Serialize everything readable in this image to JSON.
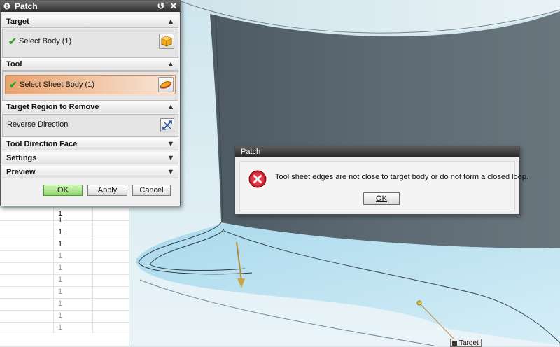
{
  "patch_dialog": {
    "title": "Patch",
    "sections": {
      "target": {
        "label": "Target",
        "select_label": "Select Body (1)"
      },
      "tool": {
        "label": "Tool",
        "select_label": "Select Sheet Body (1)"
      },
      "region": {
        "label": "Target Region to Remove",
        "reverse_label": "Reverse Direction"
      },
      "tool_direction": {
        "label": "Tool Direction Face"
      },
      "settings": {
        "label": "Settings"
      },
      "preview": {
        "label": "Preview"
      }
    },
    "buttons": {
      "ok": "OK",
      "apply": "Apply",
      "cancel": "Cancel"
    }
  },
  "error_dialog": {
    "title": "Patch",
    "message": "Tool sheet edges are not close to target body or do not form a closed loop.",
    "ok_label": "OK"
  },
  "table": {
    "values": [
      "1",
      "1",
      "1",
      "1",
      "1",
      "1",
      "1",
      "1",
      "1",
      "1",
      "1"
    ]
  },
  "viewport": {
    "target_label": "Target"
  },
  "colors": {
    "active_selection": "#e8a26e",
    "ok_button": "#8fd66a",
    "check": "#2da528",
    "error_icon": "#c9202a"
  }
}
